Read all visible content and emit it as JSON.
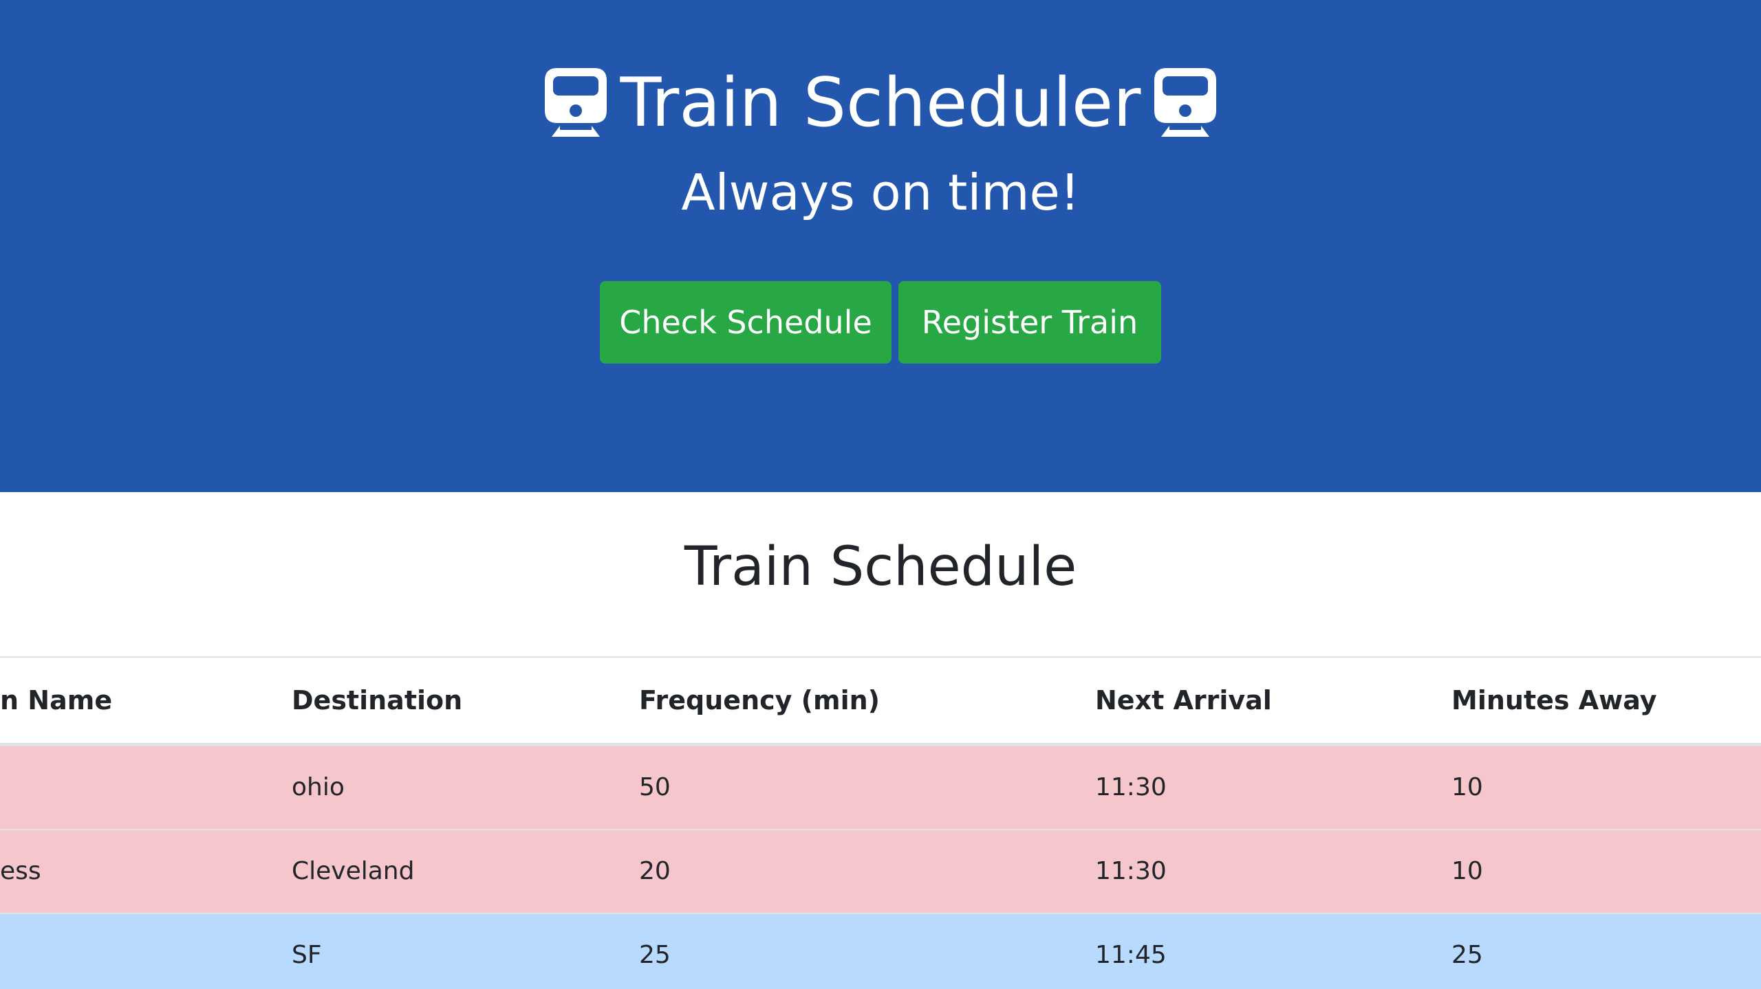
{
  "header": {
    "title": "Train Scheduler",
    "subtitle": "Always on time!",
    "left_icon": "train-icon",
    "right_icon": "train-icon",
    "buttons": {
      "check_schedule": "Check Schedule",
      "register_train": "Register Train"
    },
    "colors": {
      "background": "#2356ad",
      "button": "#28a745"
    }
  },
  "schedule": {
    "title": "Train Schedule",
    "columns": [
      "n Name",
      "Destination",
      "Frequency (min)",
      "Next Arrival",
      "Minutes Away"
    ],
    "rows": [
      {
        "name": "",
        "destination": "ohio",
        "frequency": "50",
        "next_arrival": "11:30",
        "minutes_away": "10",
        "status": "danger"
      },
      {
        "name": "ess",
        "destination": "Cleveland",
        "frequency": "20",
        "next_arrival": "11:30",
        "minutes_away": "10",
        "status": "danger"
      },
      {
        "name": "",
        "destination": "SF",
        "frequency": "25",
        "next_arrival": "11:45",
        "minutes_away": "25",
        "status": "info"
      }
    ],
    "colors": {
      "danger_row": "#f5c6cb",
      "info_row": "#b8daff"
    }
  }
}
